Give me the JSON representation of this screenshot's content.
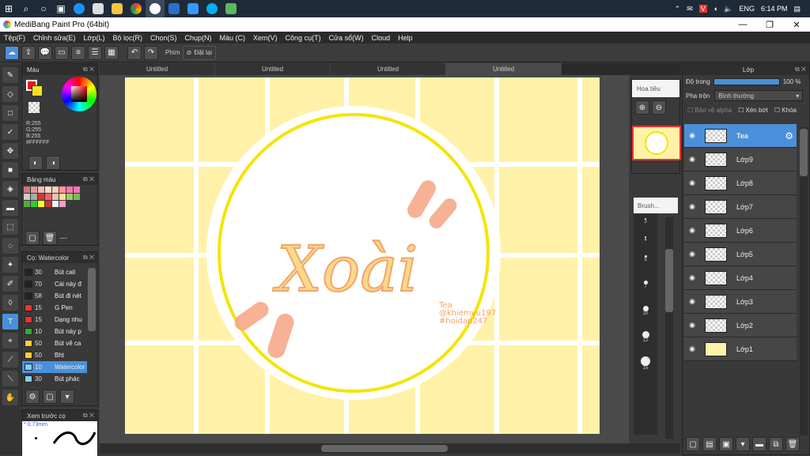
{
  "taskbar": {
    "language": "ENG",
    "time": "6:14 PM"
  },
  "window": {
    "title": "MediBang Paint Pro (64bit)",
    "minimize": "—",
    "maximize": "❐",
    "close": "✕"
  },
  "menu": [
    "Tệp(F)",
    "Chỉnh sửa(E)",
    "Lớp(L)",
    "Bộ lọc(R)",
    "Chọn(S)",
    "Chụp(N)",
    "Màu (C)",
    "Xem(V)",
    "Công cụ(T)",
    "Cửa sổ(W)",
    "Cloud",
    "Help"
  ],
  "toolbar": {
    "hotkey_label": "Phím",
    "reset_label": "Đặt lại"
  },
  "tabs": [
    "Untitled",
    "Untitled",
    "Untitled",
    "Untitled"
  ],
  "color_panel": {
    "title": "Màu",
    "r": "R:255",
    "g": "G:255",
    "b": "B:255",
    "hex": "#FFFFFF",
    "primary": "#e8171c",
    "secondary": "#f7e320"
  },
  "palette_panel": {
    "title": "Bảng màu",
    "swatches": [
      "#c77",
      "#d99",
      "#ebb",
      "#fdc",
      "#fcb",
      "#f99",
      "#f7a",
      "#e7b",
      "#ccc",
      "#aaa",
      "#d33",
      "#e66",
      "#fbb",
      "#fd9",
      "#9c6",
      "#7b5",
      "#5a4",
      "#3c3",
      "#ff3",
      "#c33",
      "#f0f0f0",
      "#f9c"
    ],
    "dash": "---"
  },
  "brush_panel": {
    "title": "Cọ: Watercolor",
    "items": [
      {
        "color": "#222",
        "size": "30",
        "name": "Bút cali"
      },
      {
        "color": "#222",
        "size": "70",
        "name": "Cái này đ"
      },
      {
        "color": "#222",
        "size": "58",
        "name": "Bút đi nét"
      },
      {
        "color": "#e33",
        "size": "15",
        "name": "G Pen"
      },
      {
        "color": "#e33",
        "size": "15",
        "name": "Dạng nhu"
      },
      {
        "color": "#3a3",
        "size": "10",
        "name": "Bút này p"
      },
      {
        "color": "#fc3",
        "size": "50",
        "name": "Bút vẽ ca"
      },
      {
        "color": "#fc3",
        "size": "50",
        "name": "Bht"
      },
      {
        "color": "#8cf",
        "size": "10",
        "name": "Watercolor"
      },
      {
        "color": "#8cf",
        "size": "30",
        "name": "Bút phác"
      }
    ]
  },
  "preview_panel": {
    "title": "Xem trước cọ",
    "size": "* 0.73mm"
  },
  "navigator": {
    "title": "Hoa tiêu"
  },
  "brush_size": {
    "title": "Brush...",
    "sizes": [
      "3",
      "4",
      "5",
      "7",
      "10",
      "12",
      "15"
    ]
  },
  "layer_panel": {
    "title": "Lớp",
    "opacity_label": "Độ trong",
    "opacity_value": "100 %",
    "blend_label": "Pha trộn",
    "blend_value": "Bình thường",
    "protect_alpha": "Bảo vệ alpha",
    "clip": "Xén bớt",
    "lock": "Khóa",
    "layers": [
      "Tea",
      "Lớp9",
      "Lớp8",
      "Lớp7",
      "Lớp6",
      "Lớp5",
      "Lớp4",
      "Lớp3",
      "Lớp2",
      "Lớp1"
    ]
  },
  "artwork": {
    "title_text": "Xoài",
    "credit_line1": "Tea",
    "credit_line2": "@khiemvu197",
    "credit_line3": "#hoidap247"
  }
}
